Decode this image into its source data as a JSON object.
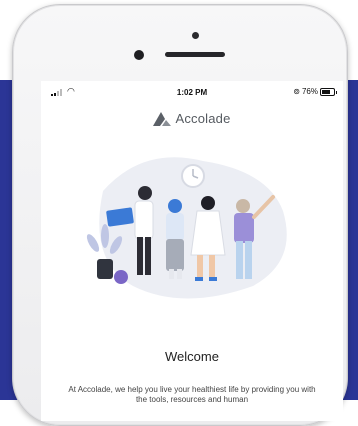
{
  "status_bar": {
    "time": "1:02 PM",
    "battery": "76%",
    "icons": [
      "signal-icon",
      "wifi-icon",
      "orientation-lock-icon",
      "battery-icon"
    ]
  },
  "brand": {
    "name": "Accolade",
    "logo_icon": "accolade-logo-icon"
  },
  "welcome": {
    "title": "Welcome",
    "body": "At Accolade, we help you live your healthiest life by providing you with the tools, resources and human"
  },
  "colors": {
    "backdrop": "#2b3596",
    "accent_blue": "#3b7ad6",
    "person_purple": "#9b8fd8"
  }
}
